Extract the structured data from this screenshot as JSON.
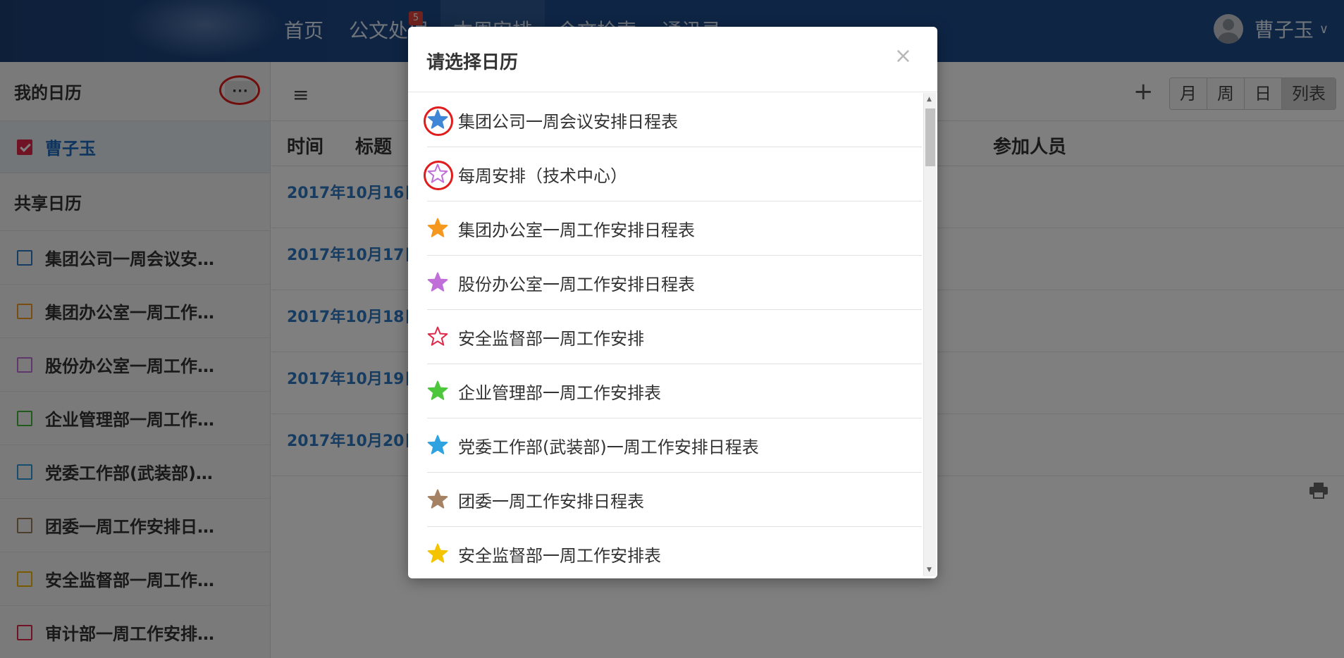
{
  "nav": {
    "items": [
      {
        "label": "首页"
      },
      {
        "label": "公文处理",
        "badge": "5"
      },
      {
        "label": "本周安排"
      },
      {
        "label": "今文检索"
      },
      {
        "label": "通讯录"
      },
      {
        "label": "···"
      }
    ],
    "user_name": "曹子玉",
    "user_caret": "∨"
  },
  "sidebar": {
    "my_title": "我的日历",
    "more_label": "···",
    "my_calendar": {
      "label": "曹子玉",
      "color": "#e0284a"
    },
    "shared_title": "共享日历",
    "shared_items": [
      {
        "label": "集团公司一周会议安…",
        "color": "#2f78c4"
      },
      {
        "label": "集团办公室一周工作…",
        "color": "#f39a1e"
      },
      {
        "label": "股份办公室一周工作…",
        "color": "#c06fd9"
      },
      {
        "label": "企业管理部一周工作…",
        "color": "#44b43b"
      },
      {
        "label": "党委工作部(武装部)…",
        "color": "#2f9ad8"
      },
      {
        "label": "团委一周工作安排日…",
        "color": "#9b7a5a"
      },
      {
        "label": "安全监督部一周工作…",
        "color": "#f0b400"
      },
      {
        "label": "审计部一周工作安排…",
        "color": "#e0284a"
      }
    ]
  },
  "toolbar": {
    "menu_icon": "≡",
    "add_icon": "+",
    "views": [
      "月",
      "周",
      "日",
      "列表"
    ]
  },
  "table": {
    "headers": {
      "time": "时间",
      "title": "标题",
      "participants": "参加人员"
    },
    "days": [
      "2017年10月16日",
      "2017年10月17日",
      "2017年10月18日",
      "2017年10月19日",
      "2017年10月20日"
    ]
  },
  "modal": {
    "title": "请选择日历",
    "close": "×",
    "items": [
      {
        "label": "集团公司一周会议安排日程表",
        "star": "filled",
        "color": "#3f86d6",
        "circled": true
      },
      {
        "label": "每周安排（技术中心）",
        "star": "outline",
        "color": "#c06fd9",
        "circled": true
      },
      {
        "label": "集团办公室一周工作安排日程表",
        "star": "filled",
        "color": "#f5981d",
        "circled": false
      },
      {
        "label": "股份办公室一周工作安排日程表",
        "star": "filled",
        "color": "#c06fd9",
        "circled": false
      },
      {
        "label": "安全监督部一周工作安排",
        "star": "outline",
        "color": "#e0284a",
        "circled": false
      },
      {
        "label": "企业管理部一周工作安排表",
        "star": "filled",
        "color": "#4cc63b",
        "circled": false
      },
      {
        "label": "党委工作部(武装部)一周工作安排日程表",
        "star": "filled",
        "color": "#2ea3e0",
        "circled": false
      },
      {
        "label": "团委一周工作安排日程表",
        "star": "filled",
        "color": "#a58263",
        "circled": false
      },
      {
        "label": "安全监督部一周工作安排表",
        "star": "filled",
        "color": "#f5c400",
        "circled": false
      }
    ]
  }
}
